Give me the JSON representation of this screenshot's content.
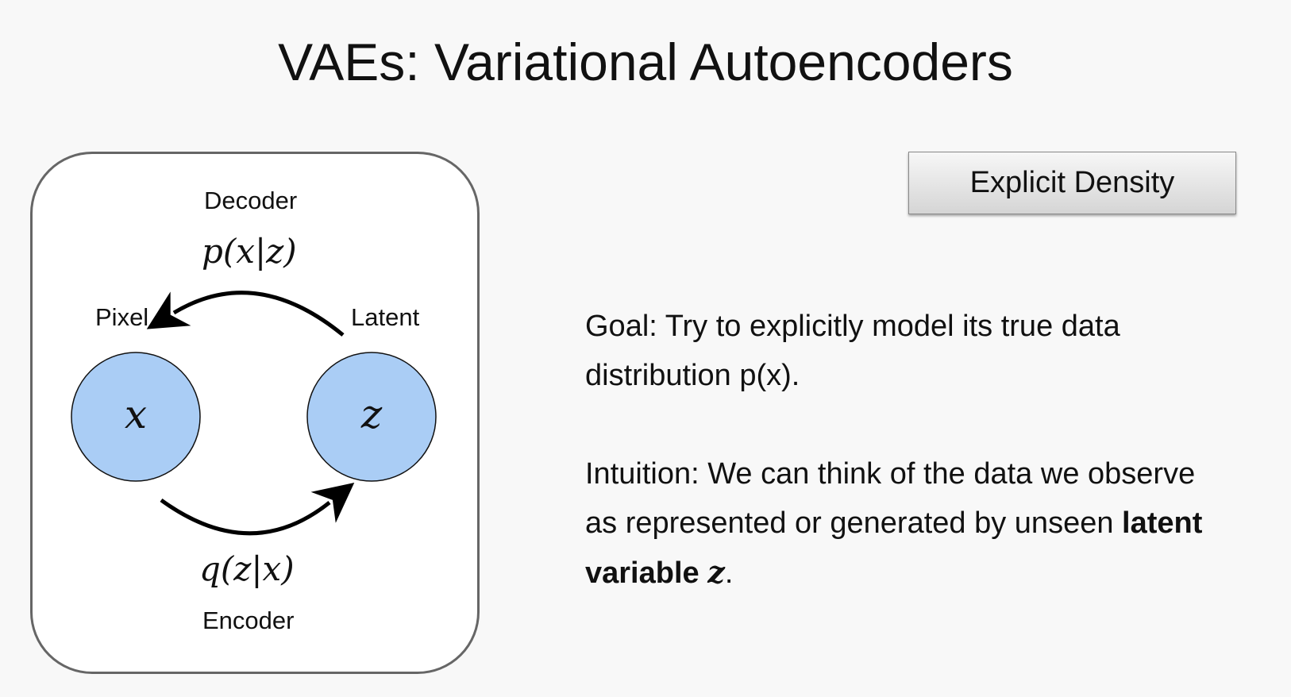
{
  "slide": {
    "title": "VAEs: Variational Autoencoders"
  },
  "badge": {
    "label": "Explicit Density"
  },
  "diagram": {
    "decoder_label": "Decoder",
    "decoder_formula": "p(x|z)",
    "encoder_label": "Encoder",
    "encoder_formula": "q(z|x)",
    "pixel_label": "Pixel",
    "latent_label": "Latent",
    "pixel_node_var": "x",
    "latent_node_var": "z",
    "node_fill": "#aacdf5"
  },
  "body": {
    "goal": "Goal: Try to explicitly model its true data distribution p(x).",
    "intuition_prefix": "Intuition: We can think of the data we observe as represented or generated by unseen ",
    "intuition_bold": "latent variable ",
    "intuition_var": "z",
    "intuition_suffix": "."
  }
}
